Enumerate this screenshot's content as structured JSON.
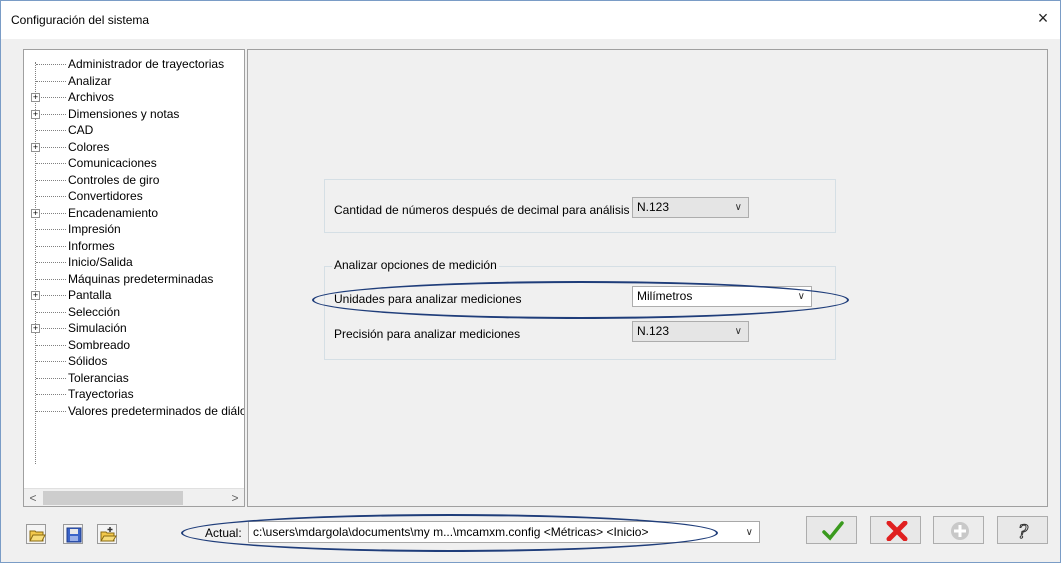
{
  "window": {
    "title": "Configuración del sistema",
    "close_glyph": "×"
  },
  "tree": {
    "items": [
      {
        "label": "Administrador de trayectorias",
        "expandable": false
      },
      {
        "label": "Analizar",
        "expandable": false
      },
      {
        "label": "Archivos",
        "expandable": true
      },
      {
        "label": "Dimensiones y notas",
        "expandable": true
      },
      {
        "label": "CAD",
        "expandable": false
      },
      {
        "label": "Colores",
        "expandable": true
      },
      {
        "label": "Comunicaciones",
        "expandable": false
      },
      {
        "label": "Controles de giro",
        "expandable": false
      },
      {
        "label": "Convertidores",
        "expandable": false
      },
      {
        "label": "Encadenamiento",
        "expandable": true
      },
      {
        "label": "Impresión",
        "expandable": false
      },
      {
        "label": "Informes",
        "expandable": false
      },
      {
        "label": "Inicio/Salida",
        "expandable": false
      },
      {
        "label": "Máquinas predeterminadas",
        "expandable": false
      },
      {
        "label": "Pantalla",
        "expandable": true
      },
      {
        "label": "Selección",
        "expandable": false
      },
      {
        "label": "Simulación",
        "expandable": true
      },
      {
        "label": "Sombreado",
        "expandable": false
      },
      {
        "label": "Sólidos",
        "expandable": false
      },
      {
        "label": "Tolerancias",
        "expandable": false
      },
      {
        "label": "Trayectorias",
        "expandable": false
      },
      {
        "label": "Valores predeterminados de diálogo",
        "expandable": false
      }
    ],
    "scroll_left": "<",
    "scroll_right": ">"
  },
  "settings": {
    "decimal_label": "Cantidad de números después de decimal para análisis",
    "decimal_value": "N.123",
    "group_label": "Analizar opciones de medición",
    "units_label": "Unidades para analizar mediciones",
    "units_value": "Milímetros",
    "precision_label": "Precisión para analizar mediciones",
    "precision_value": "N.123"
  },
  "footer": {
    "actual_label": "Actual:",
    "path_value": "c:\\users\\mdargola\\documents\\my m...\\mcamxm.config <Métricas> <Inicio>",
    "toolbar_icons": [
      "open-folder-icon",
      "save-icon",
      "merge-folder-icon"
    ],
    "action_icons": [
      "ok-check-icon",
      "cancel-x-icon",
      "add-plus-icon",
      "help-question-icon"
    ]
  },
  "colors": {
    "highlight_ellipse": "#1f3d7a",
    "ok_green": "#3a9a1e",
    "cancel_red": "#e02020"
  }
}
